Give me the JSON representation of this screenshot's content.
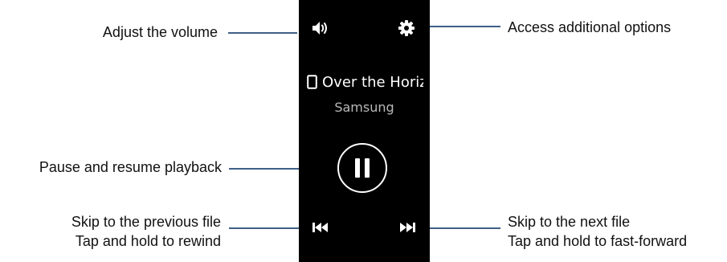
{
  "callouts": {
    "volume": "Adjust the volume",
    "options": "Access additional options",
    "pause": "Pause and resume playback",
    "prev_line1": "Skip to the previous file",
    "prev_line2": "Tap and hold to rewind",
    "next_line1": "Skip to the next file",
    "next_line2": "Tap and hold to fast-forward"
  },
  "player": {
    "track_title": "Over the Horizon",
    "artist": "Samsung",
    "icons": {
      "volume": "volume-icon",
      "settings": "gear-icon",
      "source": "phone-icon",
      "playback": "pause-icon",
      "previous": "skip-previous-icon",
      "next": "skip-next-icon"
    }
  },
  "colors": {
    "screen_background": "#000000",
    "leader_line": "#3f5f86",
    "artist_text": "#b8b8b8"
  }
}
